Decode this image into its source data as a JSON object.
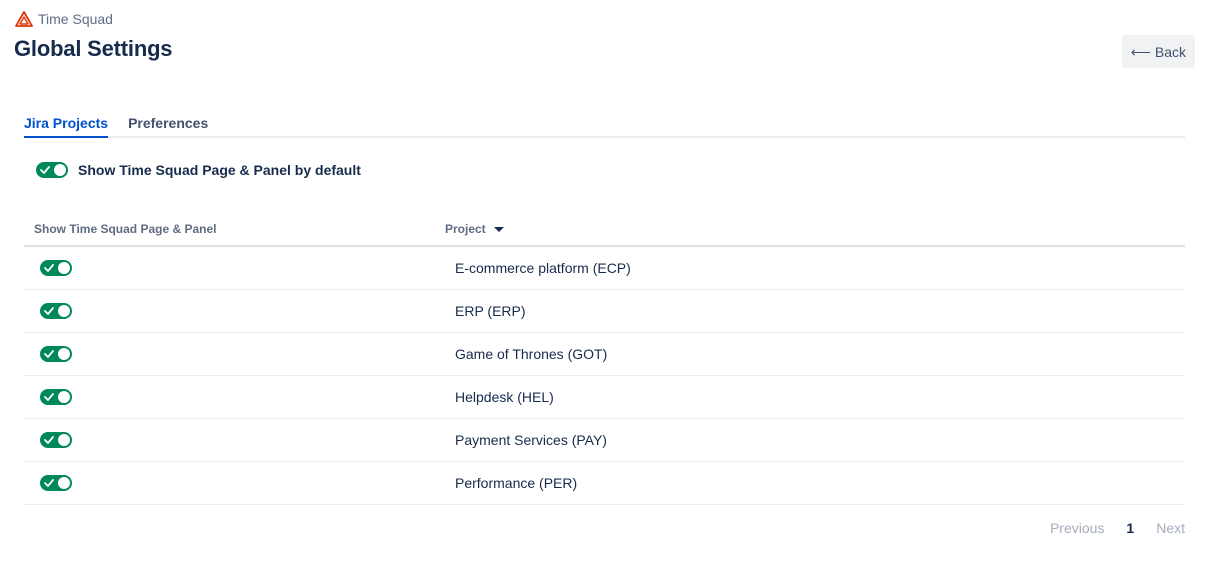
{
  "header": {
    "app_name": "Time Squad",
    "page_title": "Global Settings",
    "back_label": "Back"
  },
  "tabs": [
    {
      "label": "Jira Projects",
      "active": true
    },
    {
      "label": "Preferences",
      "active": false
    }
  ],
  "default_setting": {
    "label": "Show Time Squad Page & Panel by default",
    "enabled": true
  },
  "table": {
    "columns": [
      "Show Time Squad Page & Panel",
      "Project"
    ],
    "rows": [
      {
        "project": "E-commerce platform (ECP)",
        "enabled": true
      },
      {
        "project": "ERP (ERP)",
        "enabled": true
      },
      {
        "project": "Game of Thrones (GOT)",
        "enabled": true
      },
      {
        "project": "Helpdesk (HEL)",
        "enabled": true
      },
      {
        "project": "Payment Services (PAY)",
        "enabled": true
      },
      {
        "project": "Performance (PER)",
        "enabled": true
      }
    ]
  },
  "pagination": {
    "previous": "Previous",
    "current": "1",
    "next": "Next"
  },
  "colors": {
    "toggle_on": "#00875a",
    "tab_active": "#0052cc",
    "logo": "#de350b"
  }
}
